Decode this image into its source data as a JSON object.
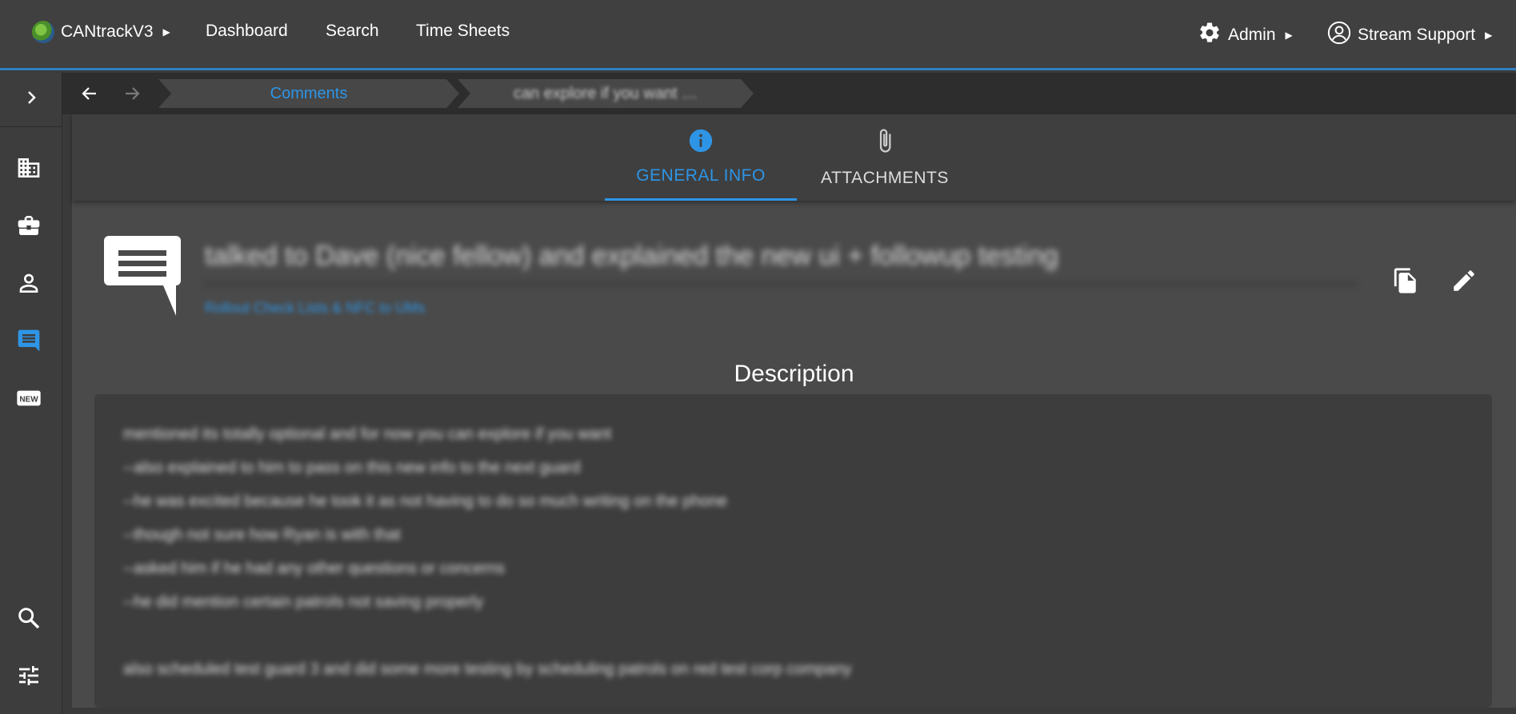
{
  "header": {
    "app_name": "CANtrackV3",
    "nav": [
      "Dashboard",
      "Search",
      "Time Sheets"
    ],
    "admin_label": "Admin",
    "user_label": "Stream Support"
  },
  "breadcrumb": {
    "items": [
      "Comments",
      "can explore if you want …"
    ]
  },
  "tabs": [
    {
      "label": "GENERAL INFO",
      "icon": "info-icon",
      "active": true
    },
    {
      "label": "ATTACHMENTS",
      "icon": "paperclip-icon",
      "active": false
    }
  ],
  "comment": {
    "title": "talked to Dave (nice fellow) and explained the new ui + followup testing",
    "subtitle": "Rollout Check Lists & NFC to UMs",
    "description_heading": "Description",
    "description_lines": [
      "mentioned its totally optional and for now you can explore if you want",
      "--also explained to him to pass on this new info to the next guard",
      "--he was excited because he took it as not having to do so much writing on the phone",
      "--though not sure how Ryan is with that",
      "--asked him if he had any other questions or concerns",
      "--he did mention certain patrols not saving properly",
      "",
      "also scheduled test guard 3 and did some more testing by scheduling patrols on red test corp company"
    ]
  },
  "colors": {
    "accent": "#2e95e6",
    "topbar": "#404040",
    "panel": "#4a4a4a"
  }
}
